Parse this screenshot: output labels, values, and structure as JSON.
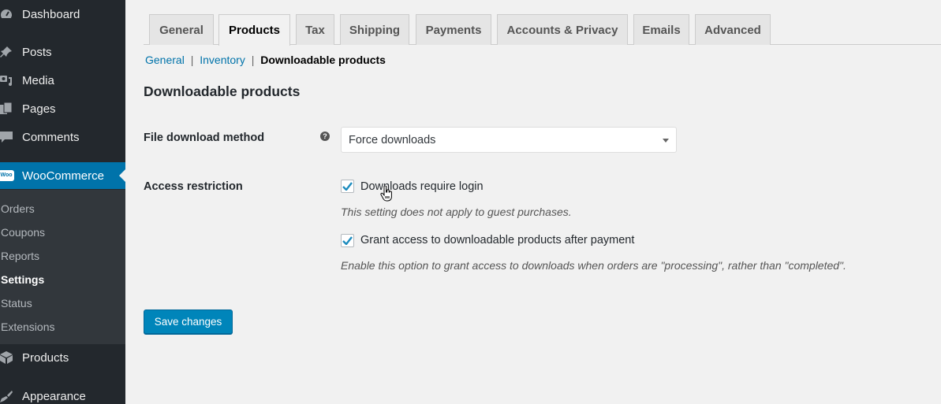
{
  "sidebar": {
    "items": [
      {
        "label": "Dashboard",
        "icon": "dashboard-icon"
      },
      {
        "label": "Posts",
        "icon": "pushpin-icon"
      },
      {
        "label": "Media",
        "icon": "media-icon"
      },
      {
        "label": "Pages",
        "icon": "pages-icon"
      },
      {
        "label": "Comments",
        "icon": "comment-icon"
      },
      {
        "label": "WooCommerce",
        "icon": "woo-icon",
        "badge": "Woo"
      },
      {
        "label": "Products",
        "icon": "box-icon"
      },
      {
        "label": "Appearance",
        "icon": "paintbrush-icon"
      }
    ],
    "submenu": [
      "Orders",
      "Coupons",
      "Reports",
      "Settings",
      "Status",
      "Extensions"
    ]
  },
  "tabs": [
    "General",
    "Products",
    "Tax",
    "Shipping",
    "Payments",
    "Accounts & Privacy",
    "Emails",
    "Advanced"
  ],
  "active_tab": "Products",
  "subnav": {
    "links": [
      "General",
      "Inventory"
    ],
    "separator": "|",
    "current": "Downloadable products"
  },
  "section": {
    "title": "Downloadable products",
    "file_download": {
      "label": "File download method",
      "help": "?",
      "value": "Force downloads"
    },
    "access": {
      "label": "Access restriction",
      "option1": {
        "label": "Downloads require login",
        "checked": true,
        "desc": "This setting does not apply to guest purchases."
      },
      "option2": {
        "label": "Grant access to downloadable products after payment",
        "checked": true,
        "desc": "Enable this option to grant access to downloads when orders are \"processing\", rather than \"completed\"."
      }
    }
  },
  "save_label": "Save changes",
  "colors": {
    "accent": "#0073aa",
    "button": "#0085ba",
    "sidebar": "#23282d"
  }
}
